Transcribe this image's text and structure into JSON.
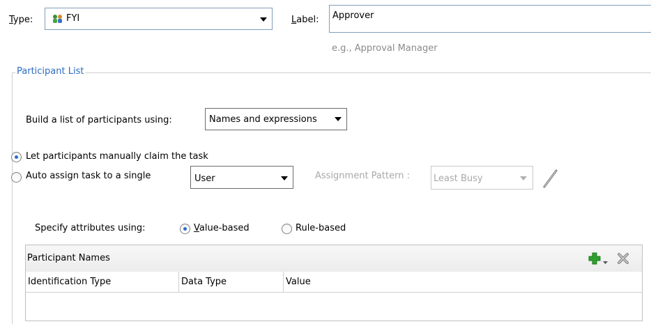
{
  "type_field": {
    "label_prefix": "",
    "label_mnemonic": "T",
    "label_rest": "ype:",
    "value": "FYI",
    "icon": "fyi-participant-icon"
  },
  "label_field": {
    "label_mnemonic": "L",
    "label_rest": "abel:",
    "value": "Approver",
    "hint": "e.g., Approval Manager"
  },
  "participant_list": {
    "title": "Participant List",
    "build_label": "Build a list of participants using:",
    "build_value": "Names and expressions",
    "radio_claim_label": "Let participants manually claim the task",
    "radio_auto_label": "Auto assign task to a single",
    "auto_assign_value": "User",
    "assignment_pattern_label": "Assignment Pattern :",
    "assignment_pattern_value": "Least Busy",
    "specify_label": "Specify attributes using:",
    "value_based_mnemonic": "V",
    "value_based_rest": "alue-based",
    "rule_based_label": "Rule-based"
  },
  "table": {
    "title": "Participant Names",
    "columns": [
      "Identification Type",
      "Data Type",
      "Value"
    ]
  },
  "colors": {
    "group_title": "#2c6cc4",
    "hint_text": "#8a8a8a",
    "disabled_text": "#a8a8a8",
    "add_icon": "#2ea02e"
  }
}
